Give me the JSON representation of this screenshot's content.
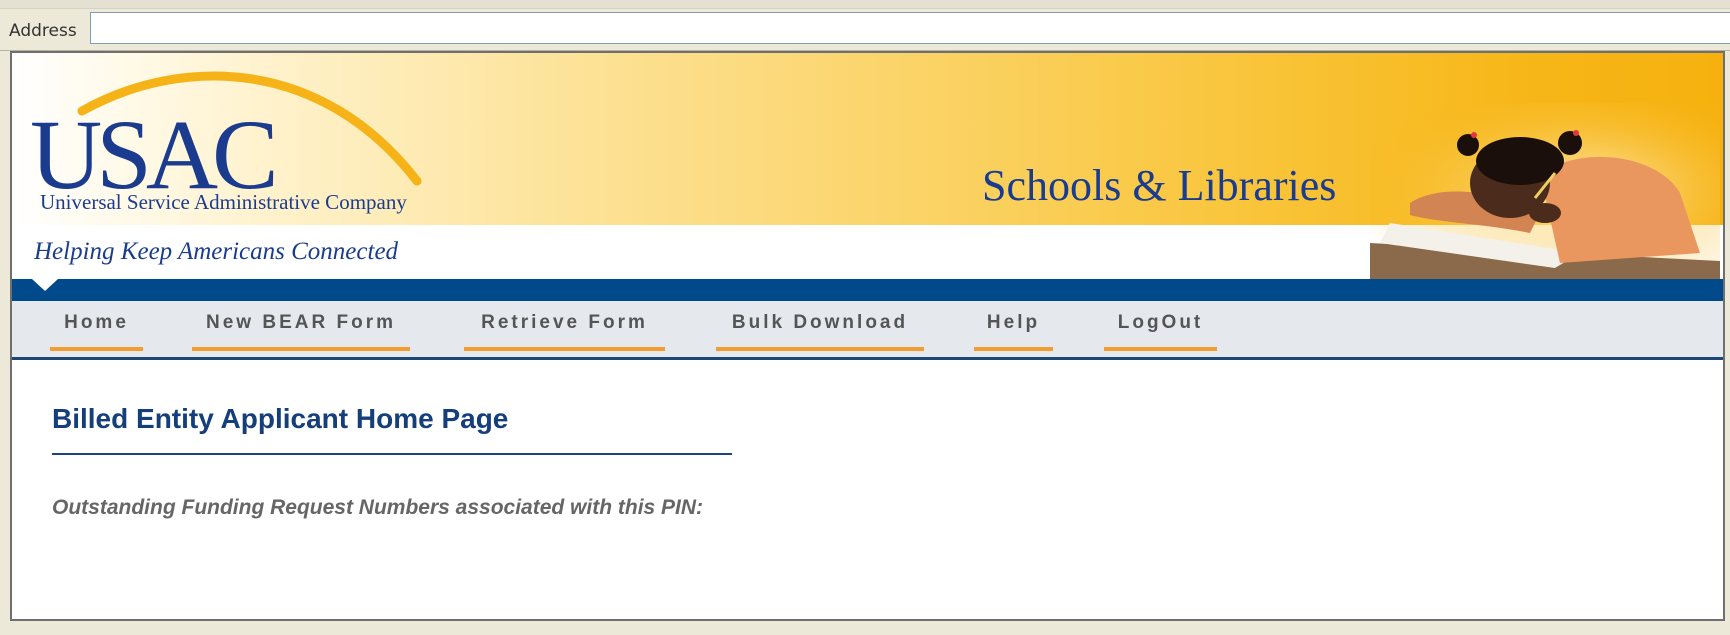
{
  "browser": {
    "address_label": "Address",
    "address_value": ""
  },
  "header": {
    "logo_text": "USAC",
    "logo_subtitle": "Universal Service Administrative Company",
    "tagline": "Helping Keep Americans Connected",
    "section_title": "Schools & Libraries"
  },
  "nav": {
    "items": [
      {
        "label": "Home"
      },
      {
        "label": "New BEAR Form"
      },
      {
        "label": "Retrieve Form"
      },
      {
        "label": "Bulk Download"
      },
      {
        "label": "Help"
      },
      {
        "label": "LogOut"
      }
    ]
  },
  "main": {
    "title": "Billed Entity Applicant Home Page",
    "text": "Outstanding Funding Request Numbers associated with this PIN:"
  },
  "colors": {
    "brand_blue": "#1b3c8e",
    "nav_bar_blue": "#004a8b",
    "nav_underline_orange": "#f39c31",
    "header_gold": "#f6b10e"
  }
}
